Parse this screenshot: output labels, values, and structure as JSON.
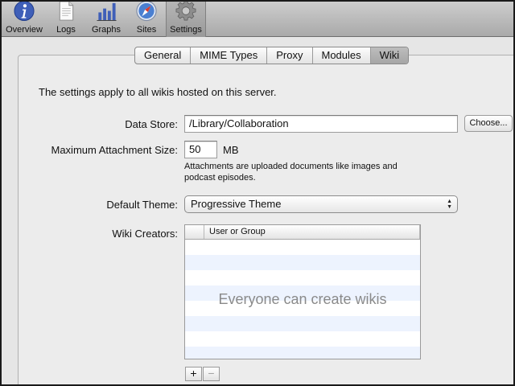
{
  "toolbar": {
    "items": [
      {
        "label": "Overview",
        "icon": "info-icon"
      },
      {
        "label": "Logs",
        "icon": "document-icon"
      },
      {
        "label": "Graphs",
        "icon": "bar-graph-icon"
      },
      {
        "label": "Sites",
        "icon": "compass-icon"
      },
      {
        "label": "Settings",
        "icon": "gear-icon",
        "selected": true
      }
    ]
  },
  "tabs": [
    {
      "label": "General"
    },
    {
      "label": "MIME Types"
    },
    {
      "label": "Proxy"
    },
    {
      "label": "Modules"
    },
    {
      "label": "Wiki",
      "selected": true
    }
  ],
  "intro": "The settings apply to all wikis hosted on this server.",
  "data_store": {
    "label": "Data Store:",
    "value": "/Library/Collaboration",
    "choose_button": "Choose..."
  },
  "attachment": {
    "label": "Maximum Attachment Size:",
    "value": "50",
    "unit": "MB",
    "help": "Attachments are uploaded documents like images and podcast episodes."
  },
  "theme": {
    "label": "Default Theme:",
    "selected": "Progressive Theme"
  },
  "wiki_creators": {
    "label": "Wiki Creators:",
    "column_header": "User or Group",
    "empty_message": "Everyone can create wikis",
    "add_button": "+",
    "remove_button": "−"
  },
  "colors": {
    "toolbar_gradient_top": "#cfcfcf",
    "stripe": "#edf3fe",
    "icon_blue": "#3f5fb8"
  }
}
